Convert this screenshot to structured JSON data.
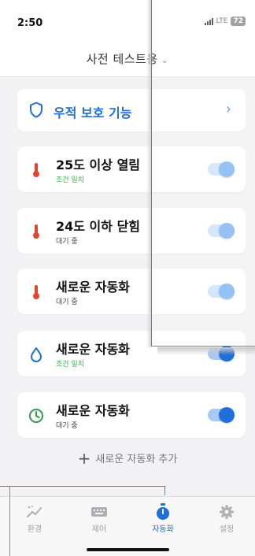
{
  "status_bar": {
    "time": "2:50",
    "network": "LTE",
    "battery": "72"
  },
  "header": {
    "title": "사전 테스트용"
  },
  "protection": {
    "label": "우적 보호 기능"
  },
  "automations": [
    {
      "title": "25도 이상 열림",
      "status": "조건 일치",
      "icon": "thermometer-icon"
    },
    {
      "title": "24도 이하 닫힘",
      "status": "대기 중",
      "icon": "thermometer-icon"
    },
    {
      "title": "새로운 자동화",
      "status": "대기 중",
      "icon": "thermometer-icon"
    },
    {
      "title": "새로운 자동화",
      "status": "조건 일치",
      "icon": "water-drop-icon"
    },
    {
      "title": "새로운 자동화",
      "status": "대기 중",
      "icon": "clock-icon"
    }
  ],
  "add_automation": {
    "label": "새로운 자동화 추가"
  },
  "tabs": [
    {
      "label": "환경",
      "icon": "environment-icon"
    },
    {
      "label": "제어",
      "icon": "keyboard-icon"
    },
    {
      "label": "자동화",
      "icon": "timer-icon",
      "active": true
    },
    {
      "label": "설정",
      "icon": "gear-icon"
    }
  ],
  "colors": {
    "accent": "#1e6fd9",
    "ok": "#2eb84a",
    "thermo": "#e0452f",
    "clock": "#2e9a4a"
  }
}
